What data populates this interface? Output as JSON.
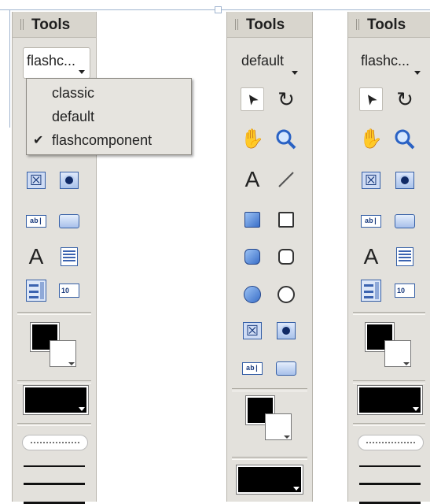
{
  "panels": [
    {
      "header": {
        "title": "Tools"
      },
      "set_selector": {
        "value": "flashc..."
      }
    },
    {
      "header": {
        "title": "Tools"
      },
      "set_selector": {
        "value": "default"
      }
    },
    {
      "header": {
        "title": "Tools"
      },
      "set_selector": {
        "value": "flashc..."
      }
    }
  ],
  "dropdown_menu": {
    "items": [
      {
        "label": "classic",
        "checked": false
      },
      {
        "label": "default",
        "checked": false
      },
      {
        "label": "flashcomponent",
        "checked": true
      }
    ],
    "check_glyph": "✔"
  },
  "tool_glyphs": {
    "arrow": "➤",
    "rotate": "↻",
    "hand": "✋",
    "text": "A",
    "line": "╱",
    "num_label": "10",
    "textinput_label": "ab|"
  },
  "icons": {
    "selection": "arrow-icon",
    "rotate": "rotate-icon",
    "hand": "hand-icon",
    "zoom": "magnifier-icon",
    "text": "text-icon",
    "line": "line-icon",
    "rect": "rectangle-icon",
    "rounded_rect": "rounded-rectangle-icon",
    "oval": "oval-icon",
    "checkbox": "checkbox-component-icon",
    "radio": "radio-component-icon",
    "textinput": "textinput-component-icon",
    "button": "button-component-icon",
    "textarea": "textarea-component-icon",
    "combobox": "combobox-component-icon",
    "numericstepper": "numericstepper-component-icon"
  },
  "colors": {
    "panel_bg": "#e3e1dc",
    "header_bg": "#d8d5cd",
    "accent_blue": "#3a6fc8",
    "stroke_color": "#000000",
    "fill_color": "#ffffff"
  }
}
